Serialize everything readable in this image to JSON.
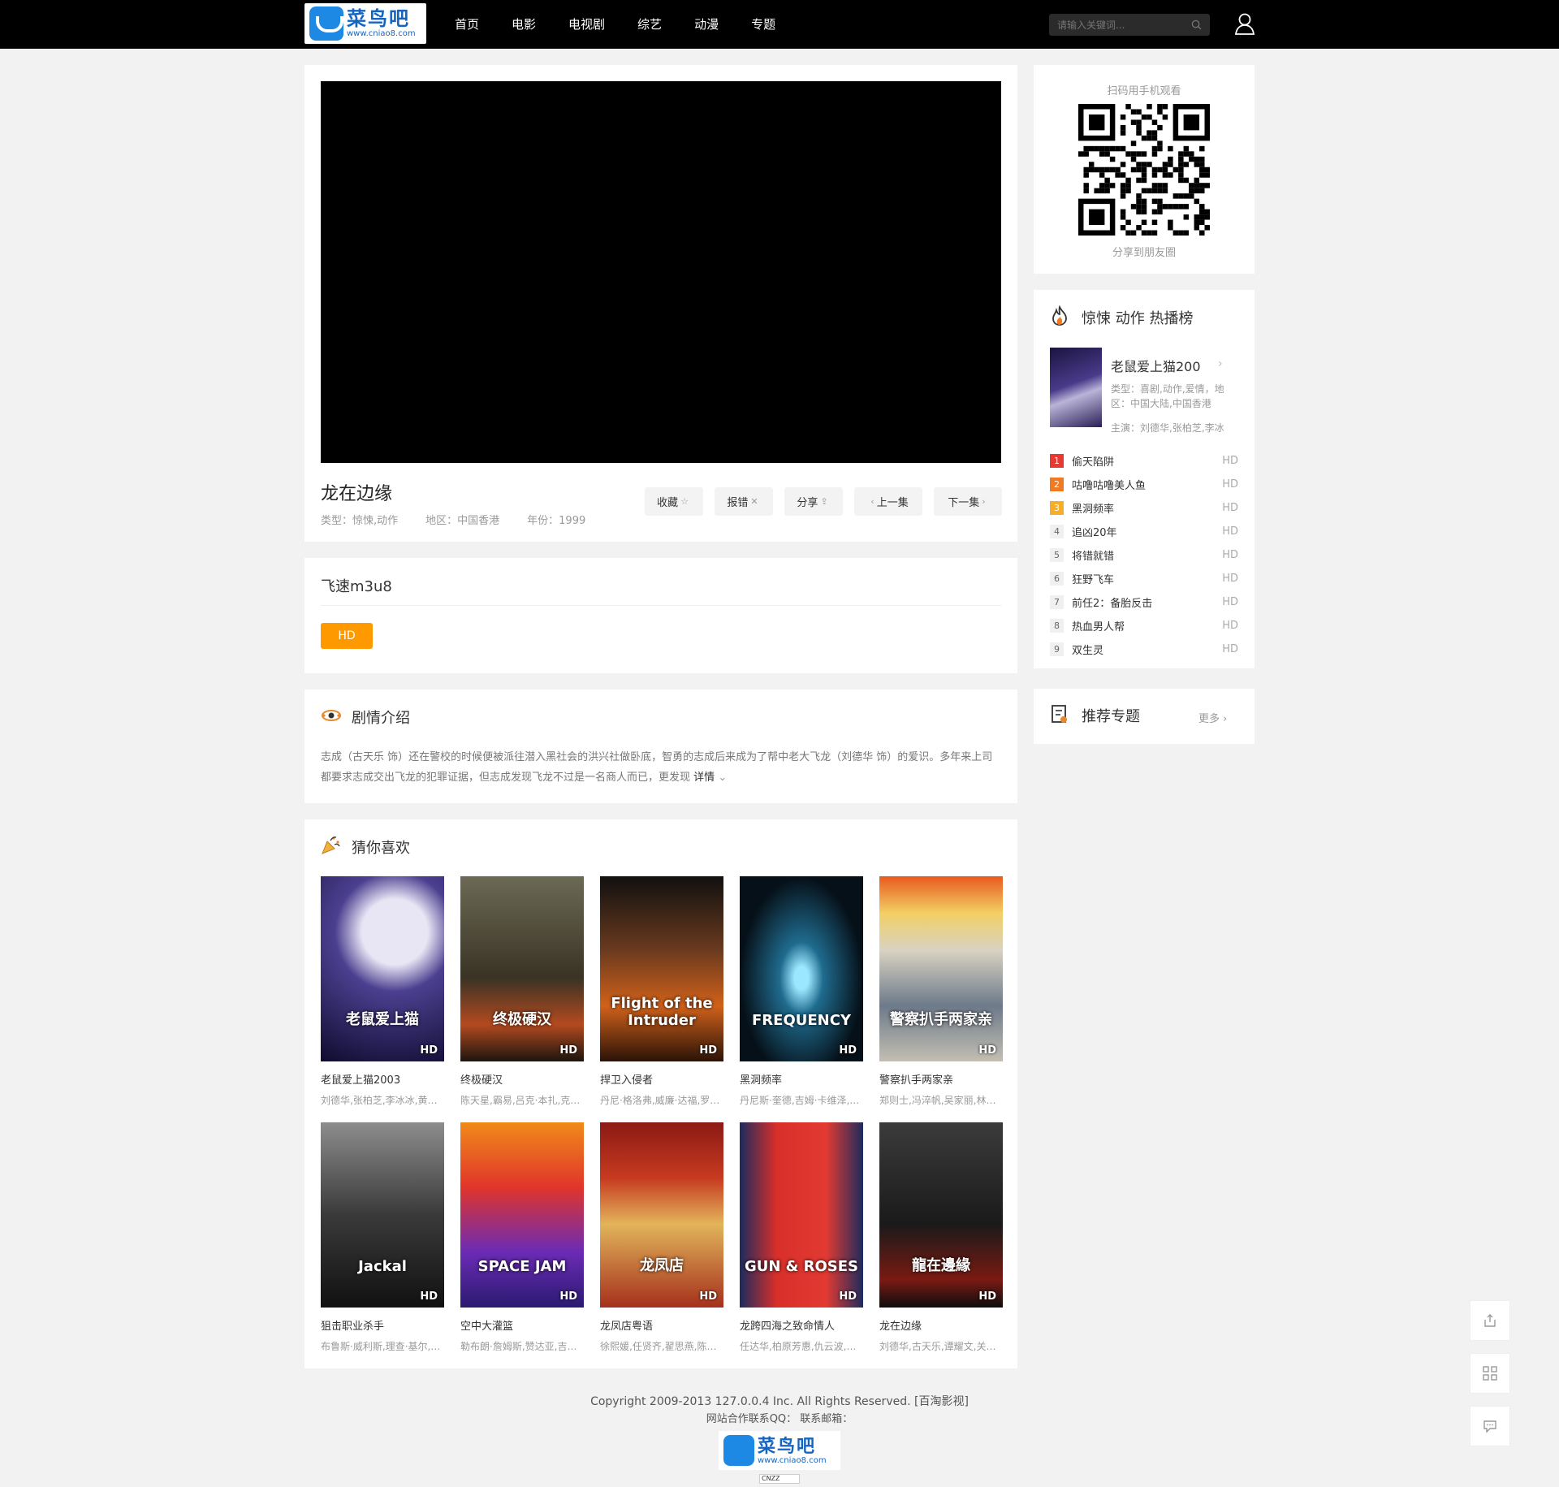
{
  "header": {
    "logo_text": "菜鸟吧",
    "logo_url": "www.cniao8.com",
    "nav": [
      "首页",
      "电影",
      "电视剧",
      "综艺",
      "动漫",
      "专题"
    ],
    "search_placeholder": "请输入关键词..."
  },
  "video": {
    "title": "龙在边缘",
    "type": "类型：惊悚,动作",
    "region": "地区：中国香港",
    "year": "年份：1999",
    "actions": [
      "收藏",
      "报错",
      "分享",
      "上一集",
      "下一集"
    ]
  },
  "source": {
    "name": "飞速m3u8",
    "episode": "HD"
  },
  "plot": {
    "heading": "剧情介绍",
    "text": "志成（古天乐 饰）还在警校的时候便被派往潜入黑社会的洪兴社做卧底，智勇的志成后来成为了帮中老大飞龙（刘德华 饰）的爱识。多年来上司都要求志成交出飞龙的犯罪证据，但志成发现飞龙不过是一名商人而已，更发现",
    "more": "详情"
  },
  "recommend": {
    "heading": "猜你喜欢",
    "badge": "HD",
    "items": [
      {
        "name": "老鼠爱上猫2003",
        "cast": "刘德华,张柏芝,李冰冰,黄秋生",
        "poster_text": "老鼠爱上猫"
      },
      {
        "name": "终极硬汉",
        "cast": "陈天星,霸易,吕克·本扎,克里斯",
        "poster_text": "终极硬汉"
      },
      {
        "name": "捍卫入侵者",
        "cast": "丹尼·格洛弗,威廉·达福,罗斯玛丽",
        "poster_text": "Flight of the Intruder"
      },
      {
        "name": "黑洞频率",
        "cast": "丹尼斯·奎德,吉姆·卡维泽,安德烈",
        "poster_text": "FREQUENCY"
      },
      {
        "name": "警察扒手两家亲",
        "cast": "郑则士,冯淬帆,吴家丽,林俊贤",
        "poster_text": "警察扒手两家亲"
      },
      {
        "name": "狙击职业杀手",
        "cast": "布鲁斯·威利斯,理查·基尔,西德尼",
        "poster_text": "Jackal"
      },
      {
        "name": "空中大灌篮",
        "cast": "勒布朗·詹姆斯,赞达亚,吉姆·克",
        "poster_text": "SPACE JAM"
      },
      {
        "name": "龙凤店粤语",
        "cast": "徐熙媛,任贤齐,翟思燕,陈百祥",
        "poster_text": "龙凤店"
      },
      {
        "name": "龙跨四海之致命情人",
        "cast": "任达华,柏原芳惠,仇云波,鹿村泰",
        "poster_text": "GUN & ROSES"
      },
      {
        "name": "龙在边缘",
        "cast": "刘德华,古天乐,谭耀文,关秀媚",
        "poster_text": "龍在邊緣"
      }
    ]
  },
  "sidebar": {
    "qr_top": "扫码用手机观看",
    "qr_bottom": "分享到朋友圈",
    "rank_title": "惊悚 动作 热播榜",
    "top": {
      "name": "老鼠爱上猫200",
      "type": "类型：喜剧,动作,爱情，地区：中国大陆,中国香港",
      "cast": "主演：刘德华,张柏芝,李冰"
    },
    "ranks": [
      {
        "num": "1",
        "name": "偷天陷阱",
        "q": "HD"
      },
      {
        "num": "2",
        "name": "咕噜咕噜美人鱼",
        "q": "HD"
      },
      {
        "num": "3",
        "name": "黑洞频率",
        "q": "HD"
      },
      {
        "num": "4",
        "name": "追凶20年",
        "q": "HD"
      },
      {
        "num": "5",
        "name": "将错就错",
        "q": "HD"
      },
      {
        "num": "6",
        "name": "狂野飞车",
        "q": "HD"
      },
      {
        "num": "7",
        "name": "前任2：备胎反击",
        "q": "HD"
      },
      {
        "num": "8",
        "name": "热血男人帮",
        "q": "HD"
      },
      {
        "num": "9",
        "name": "双生灵",
        "q": "HD"
      }
    ],
    "topic_title": "推荐专题",
    "topic_more": "更多"
  },
  "footer": {
    "copyright": "Copyright 2009-2013 127.0.0.4 Inc. All Rights Reserved. [百淘影视]",
    "contact": "网站合作联系QQ： 联系邮箱：",
    "cnzz": "CNZZ"
  }
}
